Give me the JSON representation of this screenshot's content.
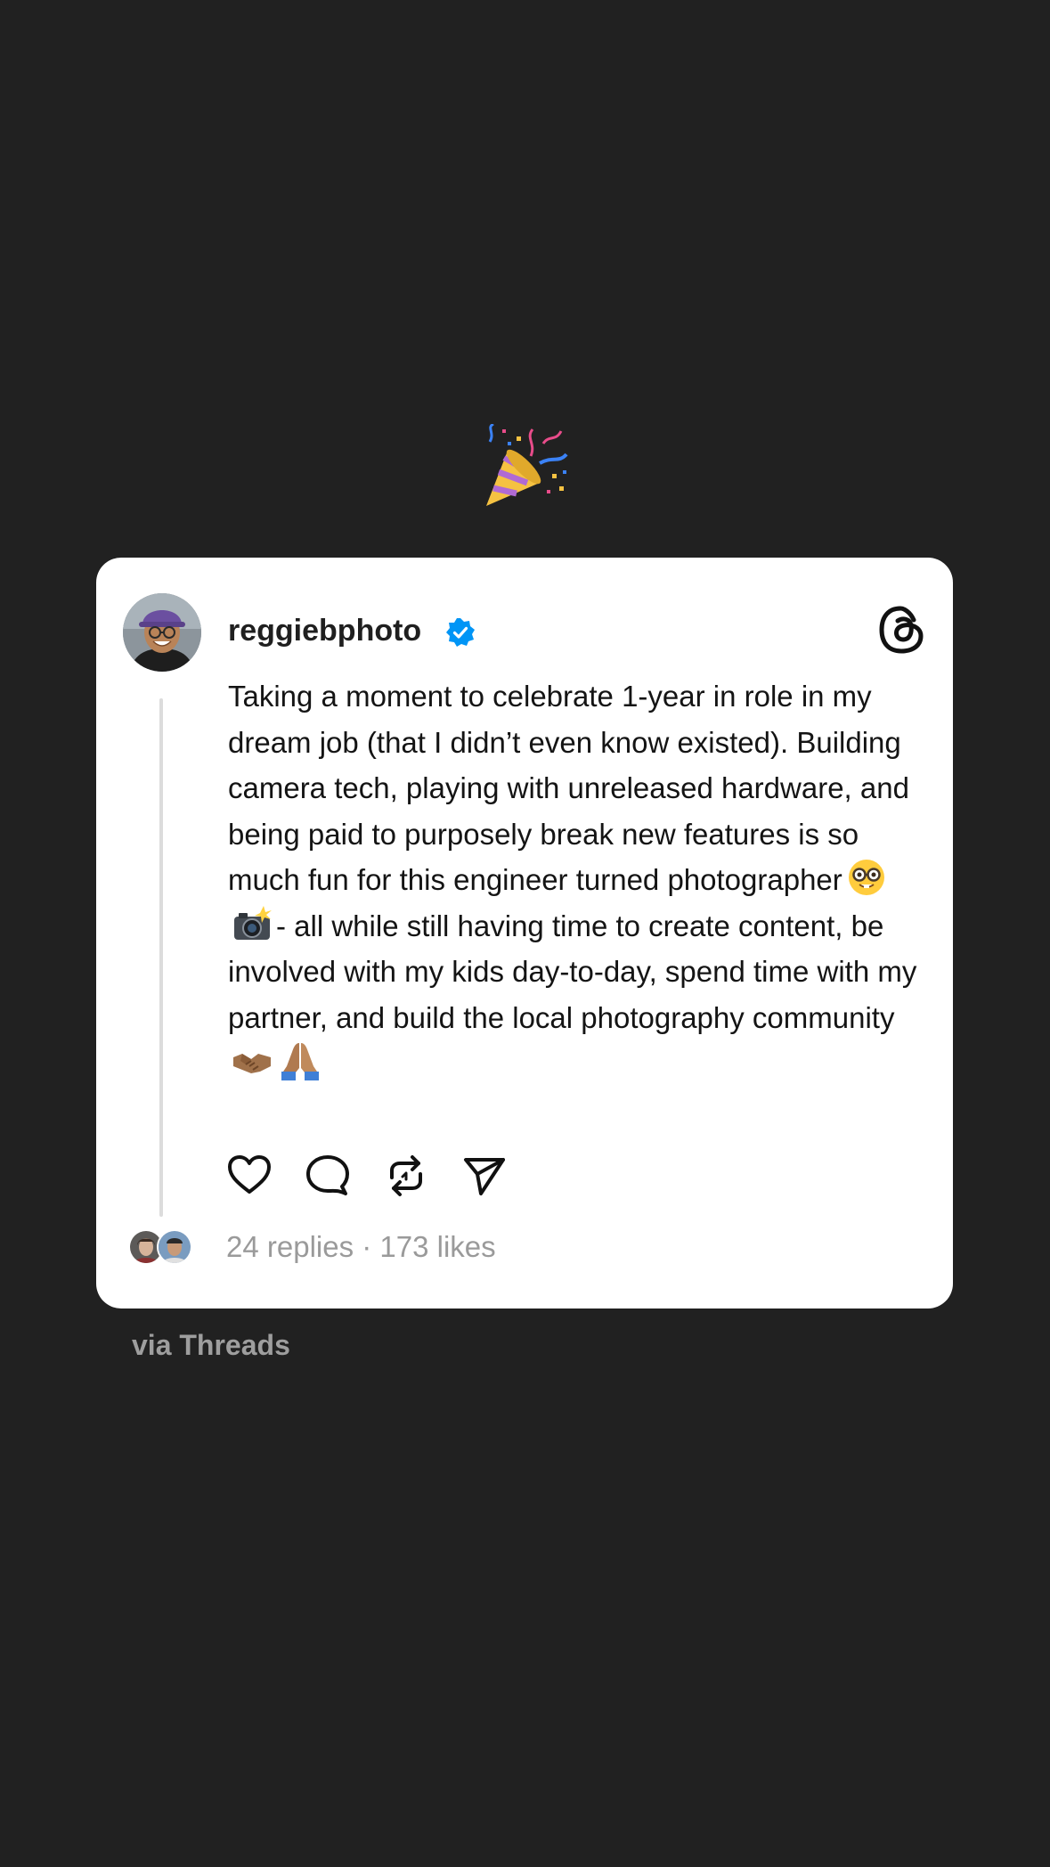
{
  "decoration": {
    "top_emoji_icon": "party-popper-icon"
  },
  "post": {
    "username": "reggiebphoto",
    "verified": true,
    "app_logo_icon": "threads-logo-icon",
    "text_parts": {
      "p1": "Taking a moment to celebrate 1-year in role in my dream job (that I didn’t even know existed). Building camera tech, playing with unreleased hardware, and being paid to purposely break new features is so much fun for this engineer turned photographer",
      "p2": "- all while still having time to create content, be involved with my kids day-to-day, spend time with my partner, and build the local photography community"
    },
    "inline_emoji_icons": [
      "nerd-face-icon",
      "camera-with-flash-icon",
      "handshake-icon",
      "folded-hands-icon"
    ],
    "actions": {
      "like_icon": "heart-icon",
      "reply_icon": "comment-bubble-icon",
      "repost_icon": "repost-icon",
      "share_icon": "send-icon"
    },
    "stats": "24 replies · 173 likes"
  },
  "footer": {
    "via_label": "via Threads"
  },
  "colors": {
    "background": "#212121",
    "card": "#ffffff",
    "verified_badge": "#0095f6",
    "muted_text": "#9a9a9a"
  }
}
